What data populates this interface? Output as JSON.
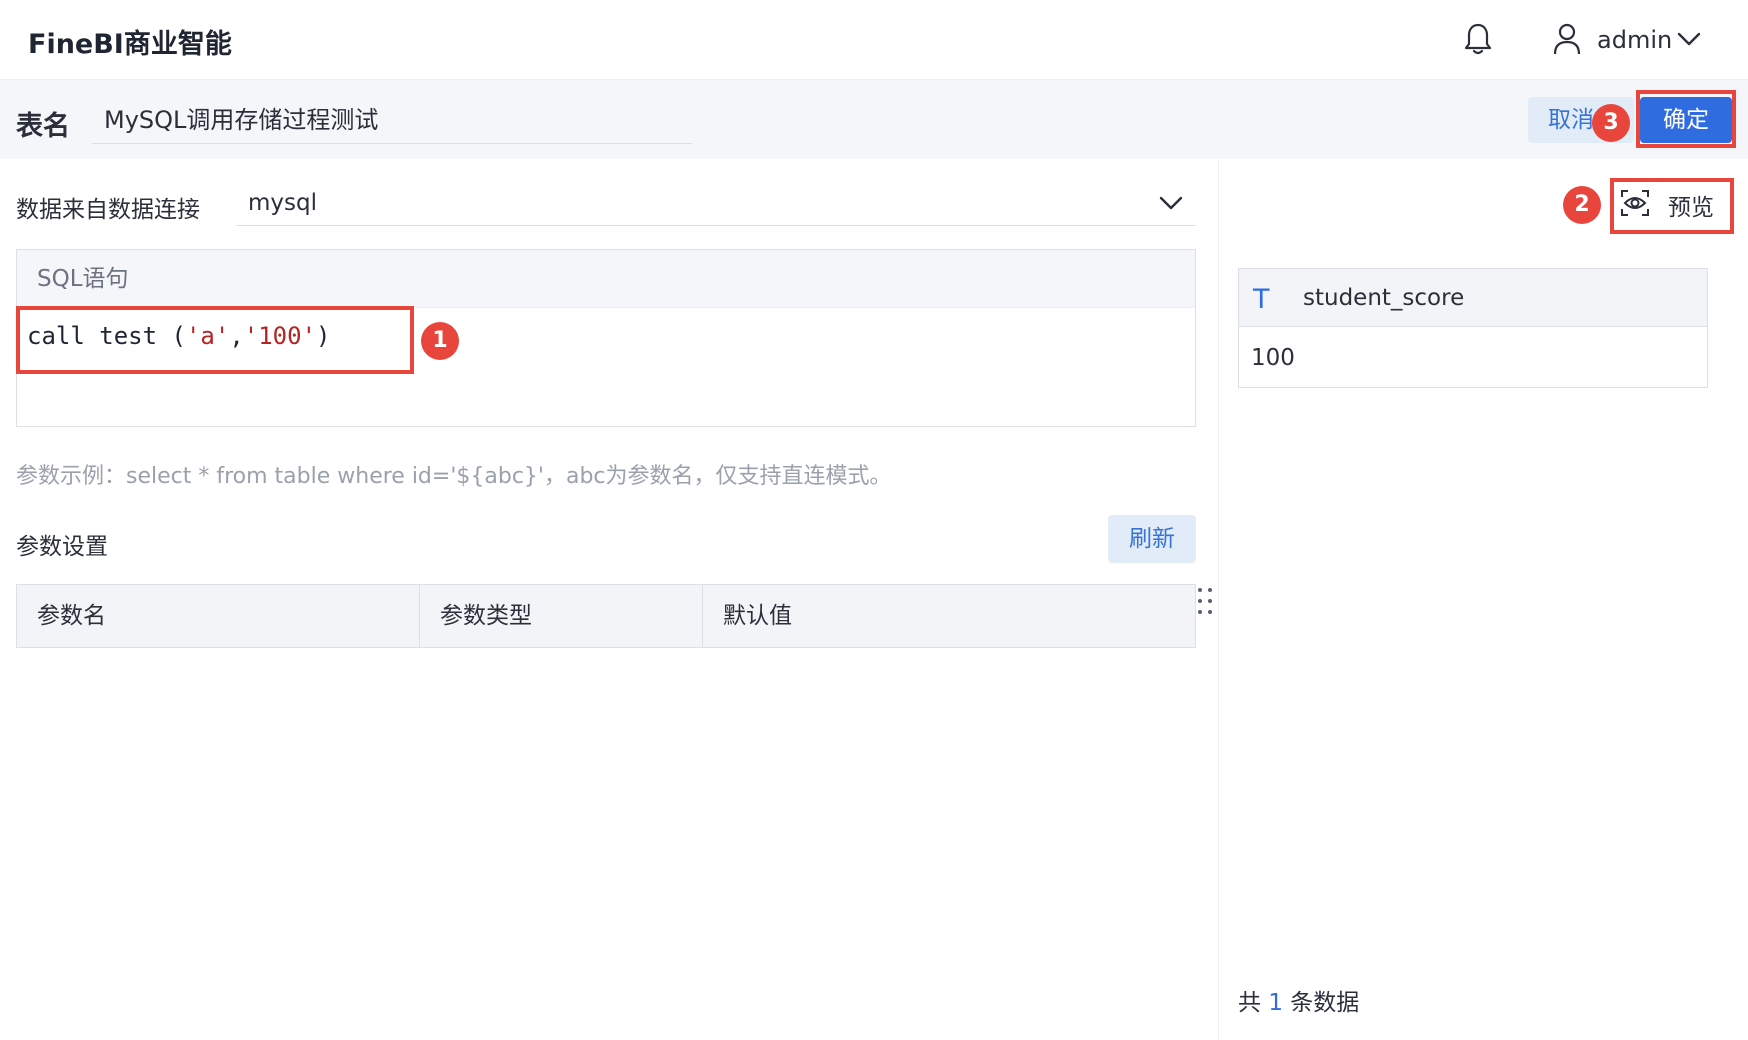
{
  "app": {
    "title": "FineBI商业智能",
    "username": "admin"
  },
  "header": {
    "table_label": "表名",
    "table_name": "MySQL调用存储过程测试",
    "cancel_label": "取消",
    "confirm_label": "确定"
  },
  "source": {
    "label": "数据来自数据连接",
    "selected": "mysql"
  },
  "sql": {
    "header": "SQL语句",
    "code_prefix": "call test (",
    "arg1": "'a'",
    "comma": ",",
    "arg2": "'100'",
    "code_suffix": ")"
  },
  "hint": "参数示例：select * from table where id='${abc}'，abc为参数名，仅支持直连模式。",
  "params": {
    "label": "参数设置",
    "refresh_label": "刷新",
    "columns": [
      "参数名",
      "参数类型",
      "默认值"
    ]
  },
  "preview": {
    "button_label": "预览",
    "column_type_icon": "T",
    "column_name": "student_score",
    "rows": [
      "100"
    ],
    "count_prefix": "共",
    "count": "1",
    "count_suffix": "条数据"
  },
  "annotations": [
    "1",
    "2",
    "3"
  ],
  "icons": {
    "bell": "bell-icon",
    "user": "user-icon",
    "chevron": "chevron-down-icon",
    "eye": "preview-eye-icon",
    "drag": "drag-handle-icon"
  },
  "colors": {
    "accent": "#2f6ce0",
    "annotation": "#e8453c",
    "secondary_button_bg": "#e2ebf8"
  }
}
